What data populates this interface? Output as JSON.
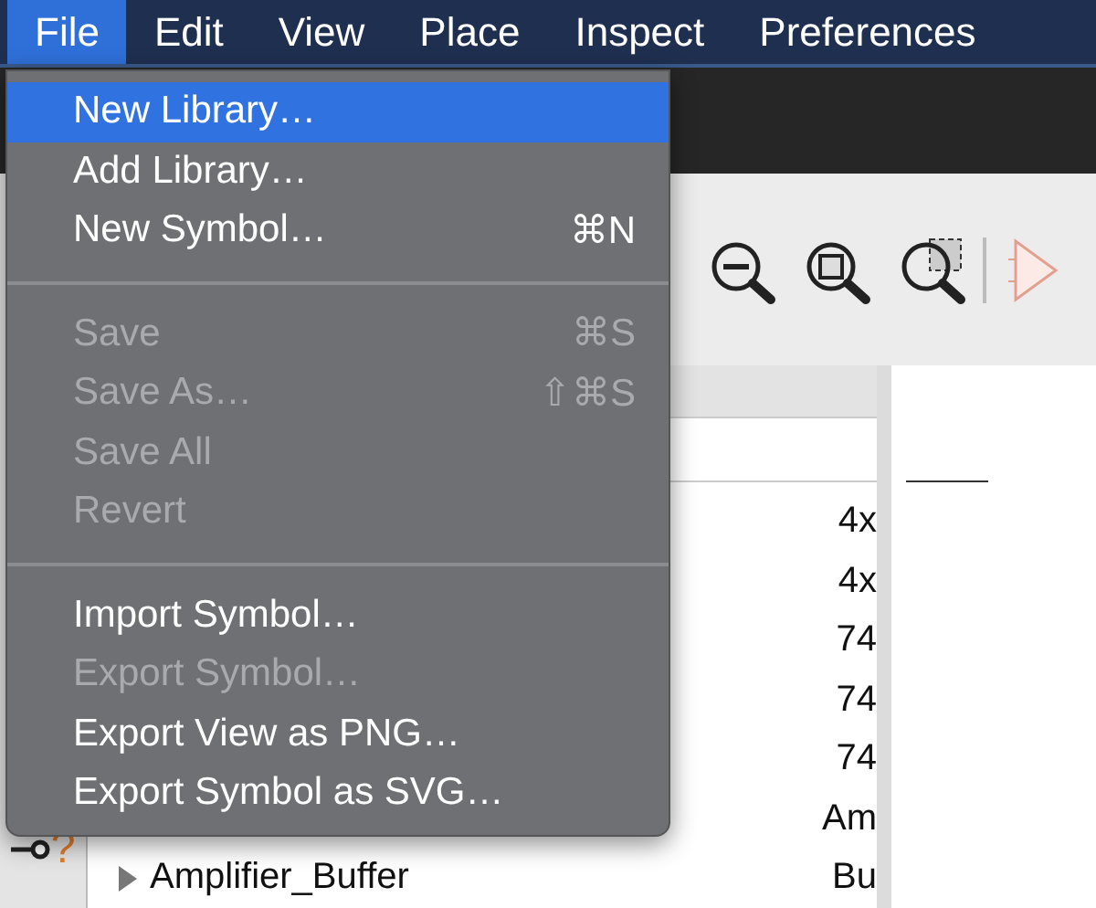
{
  "menu_bar": [
    {
      "label": "File",
      "selected": true
    },
    {
      "label": "Edit",
      "selected": false
    },
    {
      "label": "View",
      "selected": false
    },
    {
      "label": "Place",
      "selected": false
    },
    {
      "label": "Inspect",
      "selected": false
    },
    {
      "label": "Preferences",
      "selected": false
    }
  ],
  "file_menu": {
    "groups": [
      [
        {
          "label": "New Library…",
          "selected": true,
          "disabled": false
        },
        {
          "label": "Add Library…",
          "selected": false,
          "disabled": false
        },
        {
          "label": "New Symbol…",
          "shortcut": "⌘N",
          "selected": false,
          "disabled": false
        }
      ],
      [
        {
          "label": "Save",
          "shortcut": "⌘S",
          "selected": false,
          "disabled": true
        },
        {
          "label": "Save As…",
          "shortcut": "⇧⌘S",
          "selected": false,
          "disabled": true
        },
        {
          "label": "Save All",
          "selected": false,
          "disabled": true
        },
        {
          "label": "Revert",
          "selected": false,
          "disabled": true
        }
      ],
      [
        {
          "label": "Import Symbol…",
          "selected": false,
          "disabled": false
        },
        {
          "label": "Export Symbol…",
          "selected": false,
          "disabled": true
        },
        {
          "label": "Export View as PNG…",
          "selected": false,
          "disabled": false
        },
        {
          "label": "Export Symbol as SVG…",
          "selected": false,
          "disabled": false
        }
      ]
    ]
  },
  "tool_panel": {
    "help_mark": "?"
  },
  "library_table": {
    "rows": [
      {
        "column_2": "4x"
      },
      {
        "column_2": "4x"
      },
      {
        "column_2": "74"
      },
      {
        "column_2": "74"
      },
      {
        "column_2": "74"
      },
      {
        "column_2": "Am"
      },
      {
        "name": "Amplifier_Buffer",
        "expanded": false,
        "column_2": "Bu"
      }
    ]
  }
}
